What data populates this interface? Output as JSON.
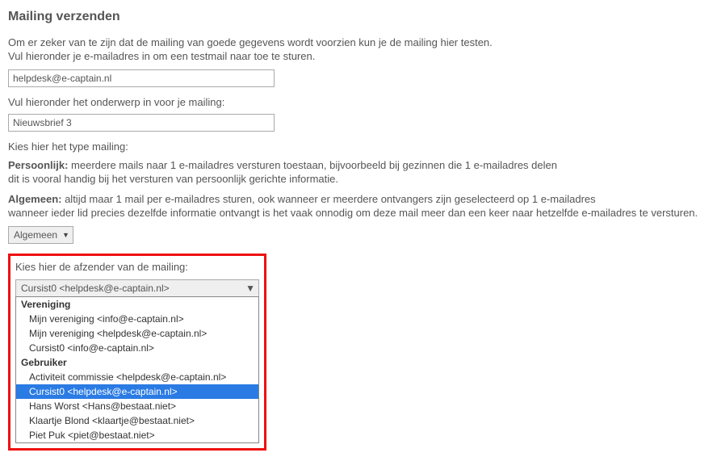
{
  "title": "Mailing verzenden",
  "intro_line1": "Om er zeker van te zijn dat de mailing van goede gegevens wordt voorzien kun je de mailing hier testen.",
  "intro_line2": "Vul hieronder je e-mailadres in om een testmail naar toe te sturen.",
  "email_value": "helpdesk@e-captain.nl",
  "subject_label": "Vul hieronder het onderwerp in voor je mailing:",
  "subject_value": "Nieuwsbrief 3",
  "type_label": "Kies hier het type mailing:",
  "type_persoonlijk_bold": "Persoonlijk:",
  "type_persoonlijk_desc1": " meerdere mails naar 1 e-mailadres versturen toestaan, bijvoorbeeld bij gezinnen die 1 e-mailadres delen",
  "type_persoonlijk_desc2": "dit is vooral handig bij het versturen van persoonlijk gerichte informatie.",
  "type_algemeen_bold": "Algemeen:",
  "type_algemeen_desc1": " altijd maar 1 mail per e-mailadres sturen, ook wanneer er meerdere ontvangers zijn geselecteerd op 1 e-mailadres",
  "type_algemeen_desc2": "wanneer ieder lid precies dezelfde informatie ontvangt is het vaak onnodig om deze mail meer dan een keer naar hetzelfde e-mailadres te versturen.",
  "type_select_value": "Algemeen",
  "sender_label": "Kies hier de afzender van de mailing:",
  "sender_select_value": "Cursist0 <helpdesk@e-captain.nl>",
  "dropdown": {
    "group1": "Vereniging",
    "g1_opt1": "Mijn vereniging <info@e-captain.nl>",
    "g1_opt2": "Mijn vereniging <helpdesk@e-captain.nl>",
    "g1_opt3": "Cursist0 <info@e-captain.nl>",
    "group2": "Gebruiker",
    "g2_opt1": "Activiteit commissie <helpdesk@e-captain.nl>",
    "g2_opt2": "Cursist0 <helpdesk@e-captain.nl>",
    "g2_opt3": "Hans Worst <Hans@bestaat.niet>",
    "g2_opt4": "Klaartje Blond <klaartje@bestaat.niet>",
    "g2_opt5": "Piet Puk <piet@bestaat.niet>"
  }
}
